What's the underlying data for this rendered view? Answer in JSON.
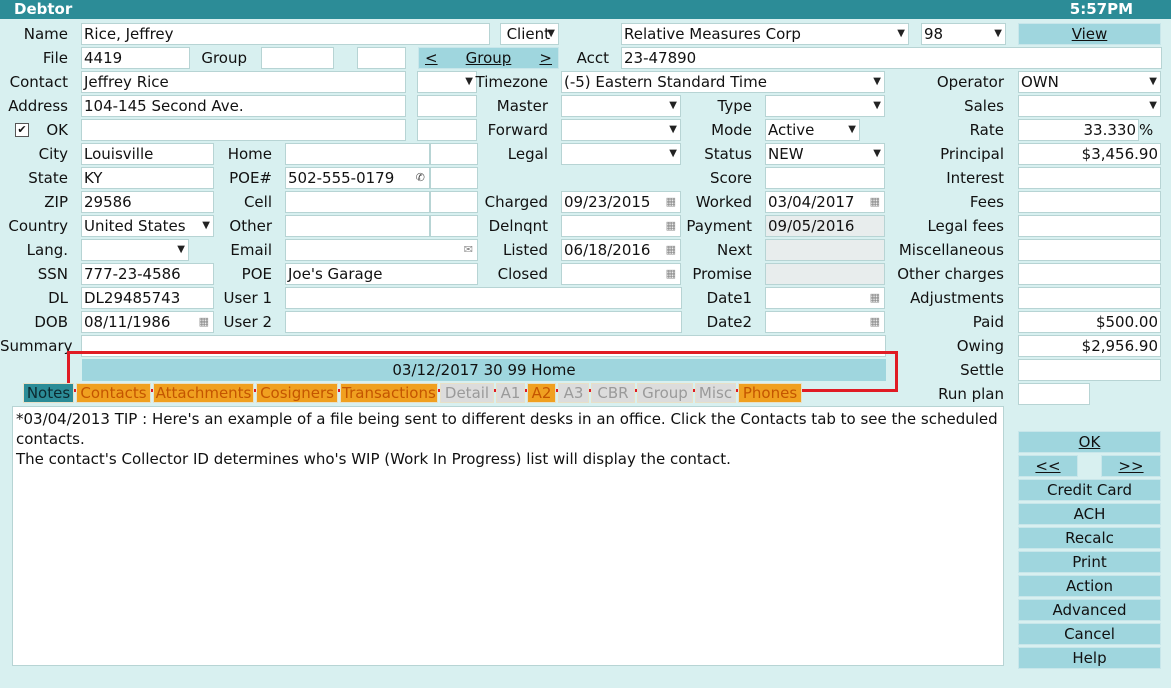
{
  "window": {
    "title": "Debtor",
    "time": "5:57PM"
  },
  "colors": {
    "accent": "#2c8c97",
    "button": "#9fd6de",
    "tab_active": "#f0a020",
    "tab_inactive": "#dcdcdc",
    "highlight": "#e01b24"
  },
  "labels": {
    "name": "Name",
    "file": "File",
    "group": "Group",
    "contact": "Contact",
    "address": "Address",
    "ok": "OK",
    "city": "City",
    "state": "State",
    "zip": "ZIP",
    "country": "Country",
    "lang": "Lang.",
    "ssn": "SSN",
    "dl": "DL",
    "dob": "DOB",
    "summary": "Summary",
    "home": "Home",
    "poe_num": "POE#",
    "cell": "Cell",
    "other": "Other",
    "email": "Email",
    "poe": "POE",
    "user1": "User 1",
    "user2": "User 2",
    "client": "Client",
    "acct": "Acct",
    "timezone": "Timezone",
    "master": "Master",
    "forward": "Forward",
    "legal": "Legal",
    "charged": "Charged",
    "delnqnt": "Delnqnt",
    "listed": "Listed",
    "closed": "Closed",
    "type": "Type",
    "mode": "Mode",
    "status": "Status",
    "score": "Score",
    "worked": "Worked",
    "payment": "Payment",
    "next": "Next",
    "promise": "Promise",
    "date1": "Date1",
    "date2": "Date2",
    "operator": "Operator",
    "sales": "Sales",
    "rate": "Rate",
    "principal": "Principal",
    "interest": "Interest",
    "fees": "Fees",
    "legal_fees": "Legal fees",
    "misc": "Miscellaneous",
    "other_charges": "Other charges",
    "adjustments": "Adjustments",
    "paid": "Paid",
    "owing": "Owing",
    "settle": "Settle",
    "run_plan": "Run plan",
    "rate_unit": "%"
  },
  "values": {
    "name": "Rice, Jeffrey",
    "file": "4419",
    "contact": "Jeffrey Rice",
    "address": "104-145 Second Ave.",
    "city": "Louisville",
    "state": "KY",
    "zip": "29586",
    "country": "United States",
    "ssn": "777-23-4586",
    "dl": "DL29485743",
    "dob": "08/11/1986",
    "poe_num": "502-555-0179",
    "poe": "Joe's Garage",
    "client": "Relative Measures Corp",
    "client_code": "98",
    "acct": "23-47890",
    "timezone": "(-5) Eastern Standard Time",
    "charged": "09/23/2015",
    "listed": "06/18/2016",
    "mode": "Active",
    "status": "NEW",
    "worked": "03/04/2017",
    "payment": "09/05/2016",
    "operator": "OWN",
    "rate": "33.330",
    "principal": "$3,456.90",
    "paid": "$500.00",
    "owing": "$2,956.90"
  },
  "buttons": {
    "group_prev": "<",
    "group": "Group",
    "group_next": ">",
    "view": "View",
    "ok": "OK",
    "prev": "<<",
    "next": ">>",
    "credit_card": "Credit Card",
    "ach": "ACH",
    "recalc": "Recalc",
    "print": "Print",
    "action": "Action",
    "advanced": "Advanced",
    "cancel": "Cancel",
    "help": "Help"
  },
  "summary_bar": "03/12/2017  30 99 Home",
  "tabs": [
    "Notes",
    "Contacts",
    "Attachments",
    "Cosigners",
    "Transactions",
    "Detail",
    "A1",
    "A2",
    "A3",
    "CBR",
    "Group",
    "Misc",
    "Phones"
  ],
  "notes": {
    "line1": "*03/04/2013 TIP : Here's an example of a file being sent to different desks in an office. Click the Contacts tab to see the scheduled contacts.",
    "line2": "The contact's Collector ID determines who's WIP (Work In Progress) list will display the contact."
  },
  "icons": {
    "dropdown": "chevron-down-icon",
    "calendar": "calendar-icon",
    "phone": "phone-icon",
    "email": "envelope-icon",
    "checkbox": "check-icon"
  }
}
